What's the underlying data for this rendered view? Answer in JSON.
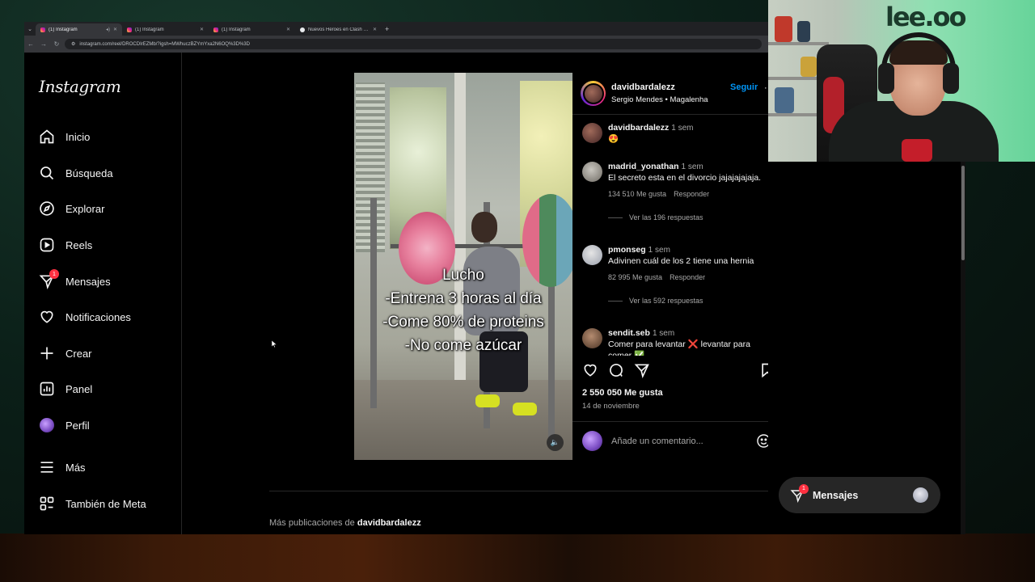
{
  "browser": {
    "tabs": [
      {
        "title": "(1) Instagram",
        "active": true,
        "audio": true
      },
      {
        "title": "(1) Instagram",
        "active": false
      },
      {
        "title": "(1) Instagram",
        "active": false
      },
      {
        "title": "Nuevos Héroes en Clash Royale",
        "active": false
      }
    ],
    "url": "instagram.com/reel/DROCDIrEZMb/?igsh=MWhuczBZYmYxa2N6OQ%3D%3D"
  },
  "sidebar": {
    "logo": "Instagram",
    "items": [
      {
        "label": "Inicio",
        "icon": "home-icon"
      },
      {
        "label": "Búsqueda",
        "icon": "search-icon"
      },
      {
        "label": "Explorar",
        "icon": "compass-icon"
      },
      {
        "label": "Reels",
        "icon": "reels-icon"
      },
      {
        "label": "Mensajes",
        "icon": "messages-icon",
        "badge": "1"
      },
      {
        "label": "Notificaciones",
        "icon": "heart-icon"
      },
      {
        "label": "Crear",
        "icon": "plus-icon"
      },
      {
        "label": "Panel",
        "icon": "dashboard-icon"
      },
      {
        "label": "Perfil",
        "icon": "profile-avatar"
      },
      {
        "label": "Más",
        "icon": "menu-icon"
      },
      {
        "label": "También de Meta",
        "icon": "meta-apps-icon"
      }
    ]
  },
  "reel": {
    "caption_lines": [
      "Lucho",
      "-Entrena 3 horas al día",
      "-Come 80% de proteins",
      "-No come azúcar"
    ]
  },
  "post": {
    "author": "davidbardalezz",
    "subtitle": "Sergio Mendes • Magalenha",
    "follow_label": "Seguir",
    "comments": [
      {
        "user": "davidbardalezz",
        "time": "1 sem",
        "text": "😍"
      },
      {
        "user": "madrid_yonathan",
        "time": "1 sem",
        "text": "El secreto esta en el divorcio jajajajajaja.",
        "likes": "134 510 Me gusta",
        "reply": "Responder",
        "replies": "Ver las 196 respuestas"
      },
      {
        "user": "pmonseg",
        "time": "1 sem",
        "text": "Adivinen cuál de los 2 tiene una hernia",
        "likes": "82 995 Me gusta",
        "reply": "Responder",
        "replies": "Ver las 592 respuestas"
      },
      {
        "user": "sendit.seb",
        "time": "1 sem",
        "text": "Comer para levantar ❌ levantar para comer ✅"
      }
    ],
    "likes_total": "2 550 050 Me gusta",
    "date": "14 de noviembre",
    "comment_placeholder": "Añade un comentario...",
    "more_posts_prefix": "Más publicaciones de",
    "more_posts_user": "davidbardalezz"
  },
  "floating_messages": {
    "label": "Mensajes",
    "badge": "1"
  },
  "webcam": {
    "logo_text": "lee.oo"
  },
  "colors": {
    "accent": "#0095f6",
    "badge": "#ff3040",
    "background": "#000000"
  }
}
